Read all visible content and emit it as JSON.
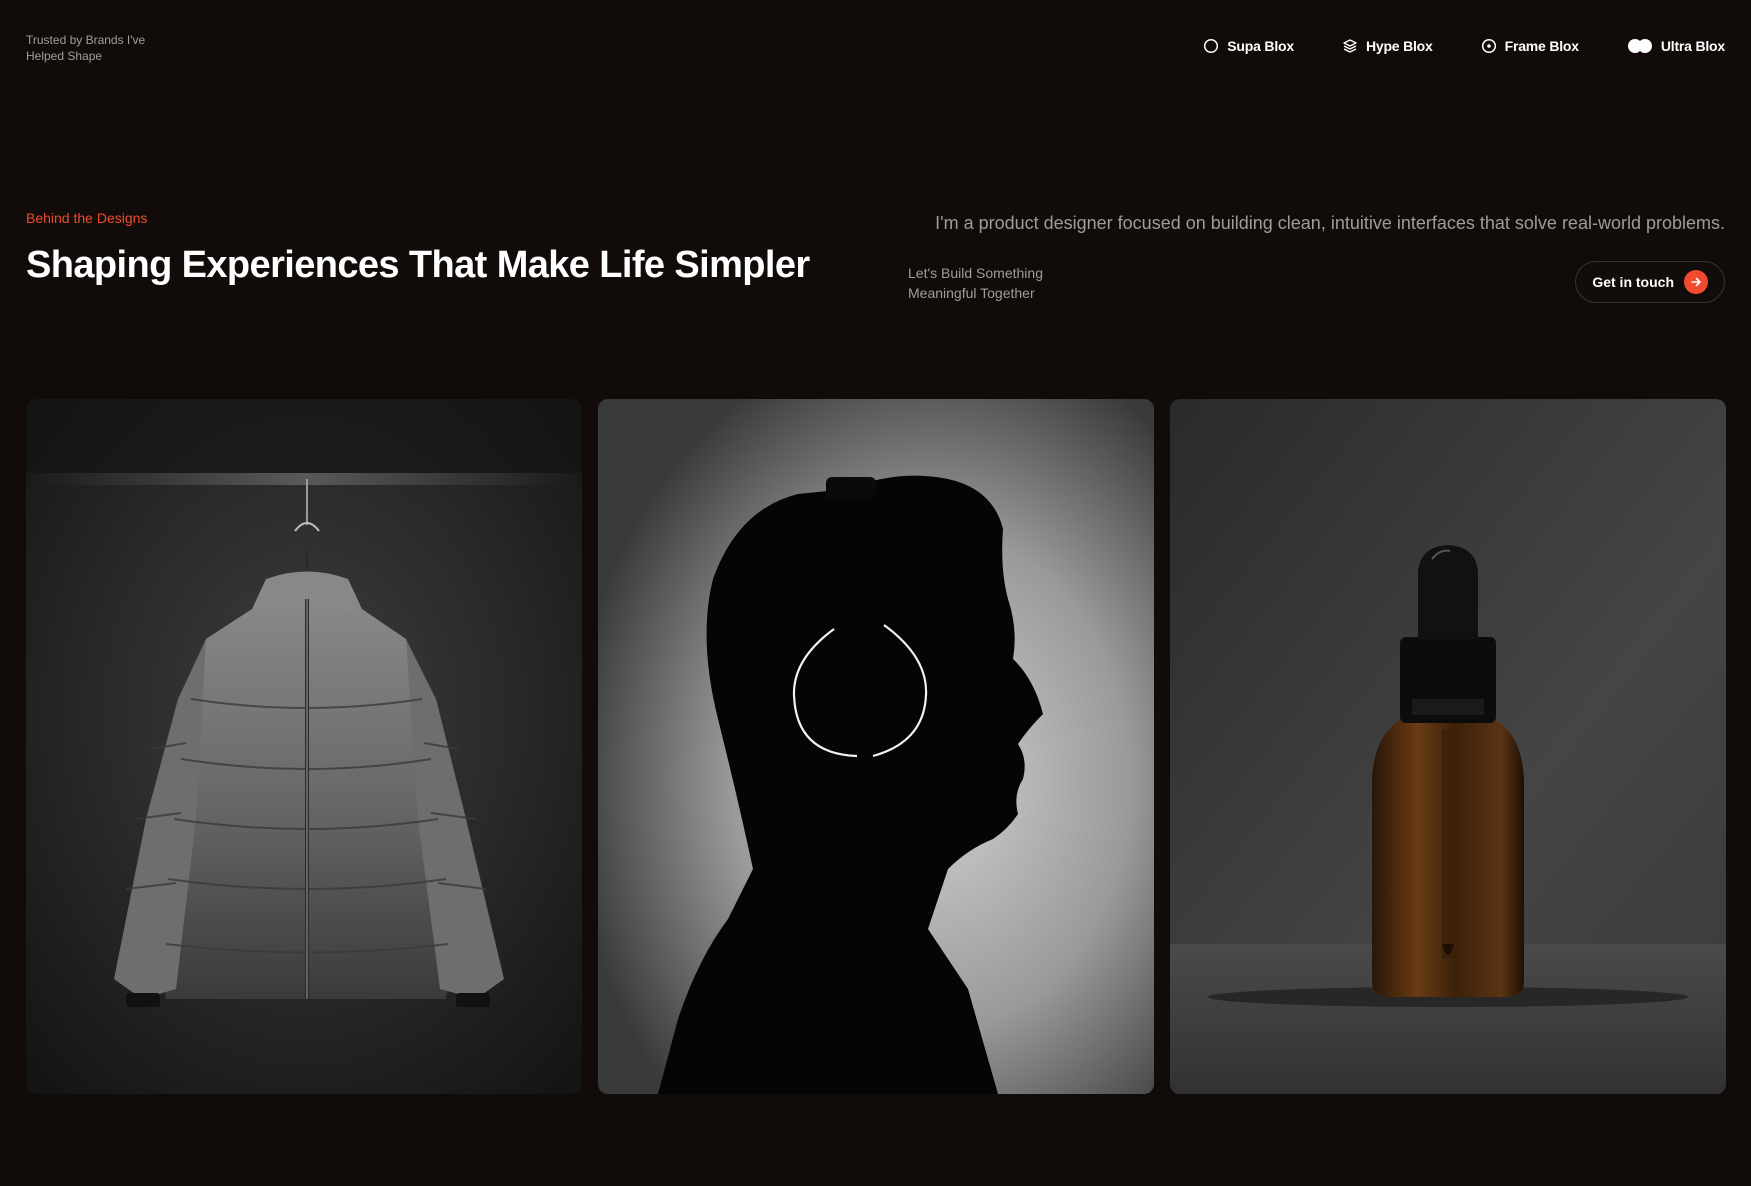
{
  "header": {
    "trusted_text": "Trusted by Brands I've Helped Shape",
    "brands": [
      {
        "label": "Supa Blox",
        "icon": "circle-outline-icon"
      },
      {
        "label": "Hype Blox",
        "icon": "layers-icon"
      },
      {
        "label": "Frame Blox",
        "icon": "target-circle-icon"
      },
      {
        "label": "Ultra Blox",
        "icon": "pill-toggle-icon"
      }
    ]
  },
  "hero": {
    "eyebrow": "Behind the Designs",
    "headline": "Shaping Experiences That Make Life Simpler",
    "intro": "I'm a product designer focused on building clean, intuitive interfaces that solve real-world problems.",
    "cta_subtext": "Let's Build Something Meaningful Together",
    "cta_label": "Get in touch",
    "cta_icon": "arrow-right-icon"
  },
  "gallery": {
    "images": [
      {
        "name": "puffer-jacket-image"
      },
      {
        "name": "headphones-silhouette-image"
      },
      {
        "name": "dropper-bottle-image"
      }
    ]
  },
  "colors": {
    "background": "#110c09",
    "accent": "#f04a2f",
    "muted_text": "#a39b95"
  }
}
